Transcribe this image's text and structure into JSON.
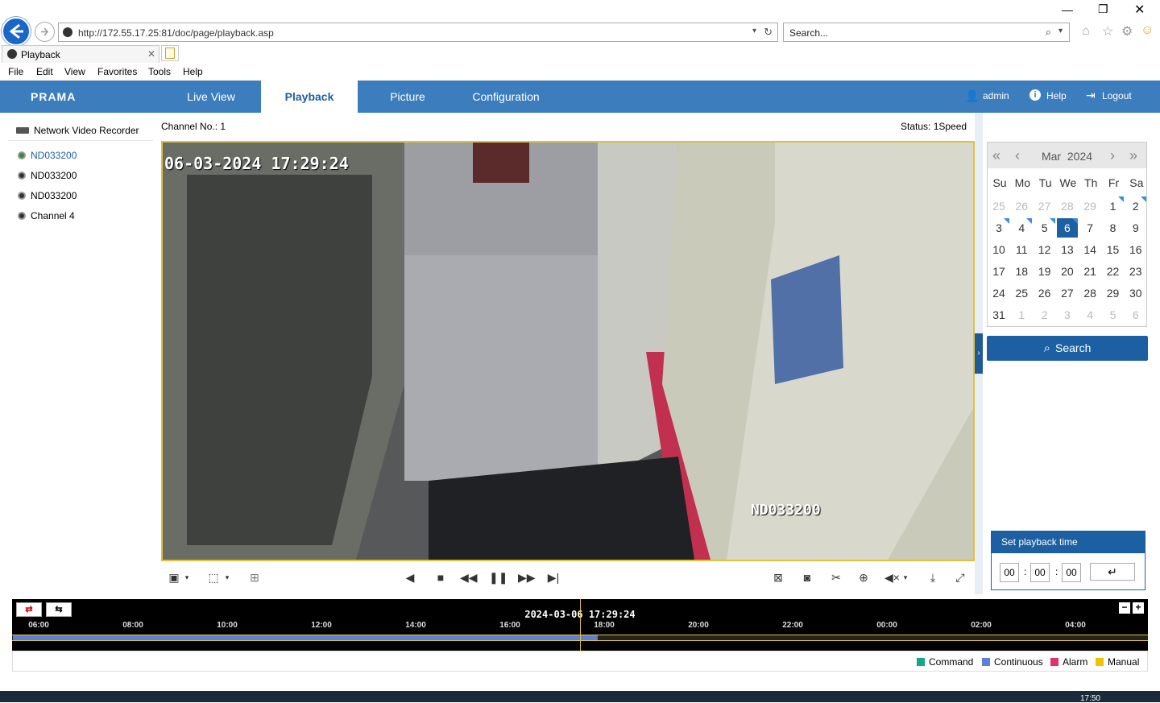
{
  "browser": {
    "url": "http://172.55.17.25:81/doc/page/playback.asp",
    "search_placeholder": "Search...",
    "tab_title": "Playback",
    "menu": [
      "File",
      "Edit",
      "View",
      "Favorites",
      "Tools",
      "Help"
    ]
  },
  "header": {
    "logo": "PRAMA",
    "tabs": [
      "Live View",
      "Playback",
      "Picture",
      "Configuration"
    ],
    "active_tab": "Playback",
    "user": "admin",
    "help": "Help",
    "logout": "Logout"
  },
  "device_tree": {
    "root": "Network Video Recorder",
    "channels": [
      "ND033200",
      "ND033200",
      "ND033200",
      "Channel 4"
    ]
  },
  "video": {
    "channel_label": "Channel No.: 1",
    "status_label": "Status: 1Speed",
    "osd_timestamp": "06-03-2024 17:29:24",
    "osd_camera_name": "ND033200"
  },
  "calendar": {
    "month": "Mar",
    "year": "2024",
    "days_of_week": [
      "Su",
      "Mo",
      "Tu",
      "We",
      "Th",
      "Fr",
      "Sa"
    ],
    "weeks": [
      [
        "25",
        "26",
        "27",
        "28",
        "29",
        "1",
        "2"
      ],
      [
        "3",
        "4",
        "5",
        "6",
        "7",
        "8",
        "9"
      ],
      [
        "10",
        "11",
        "12",
        "13",
        "14",
        "15",
        "16"
      ],
      [
        "17",
        "18",
        "19",
        "20",
        "21",
        "22",
        "23"
      ],
      [
        "24",
        "25",
        "26",
        "27",
        "28",
        "29",
        "30"
      ],
      [
        "31",
        "1",
        "2",
        "3",
        "4",
        "5",
        "6"
      ]
    ],
    "selected_day": "6",
    "search_label": "Search"
  },
  "set_playback_time": {
    "title": "Set playback time",
    "hh": "00",
    "mm": "00",
    "ss": "00"
  },
  "timeline": {
    "current": "2024-03-06 17:29:24",
    "ticks": [
      "06:00",
      "08:00",
      "10:00",
      "12:00",
      "14:00",
      "16:00",
      "18:00",
      "20:00",
      "22:00",
      "00:00",
      "02:00",
      "04:00"
    ]
  },
  "legend": [
    {
      "label": "Command",
      "color": "#19a38a"
    },
    {
      "label": "Continuous",
      "color": "#5c7fdc"
    },
    {
      "label": "Alarm",
      "color": "#e0336e"
    },
    {
      "label": "Manual",
      "color": "#f0c400"
    }
  ],
  "colors": {
    "header_bg": "#3c7dbd",
    "accent": "#1d5fa3",
    "video_border": "#e0c23a"
  },
  "taskbar_time": "17:50"
}
